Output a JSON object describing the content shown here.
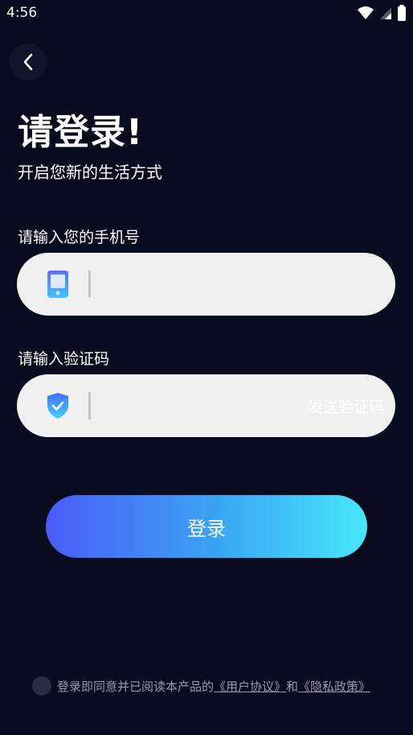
{
  "status_bar": {
    "time": "4:56"
  },
  "header": {
    "title": "请登录!",
    "subtitle": "开启您新的生活方式"
  },
  "phone": {
    "label": "请输入您的手机号",
    "value": ""
  },
  "code": {
    "label": "请输入验证码",
    "value": "",
    "send_label": "发送验证码"
  },
  "login_button": {
    "label": "登录"
  },
  "agreement": {
    "prefix": "登录即同意并已阅读本产品的",
    "user_agreement": "《用户协议》",
    "conj": "和",
    "privacy_policy": "《隐私政策》"
  },
  "colors": {
    "background": "#090b1f",
    "input_bg": "#f0f0f0",
    "accent_start": "#4a5cf7",
    "accent_end": "#47e7fb"
  },
  "icons": {
    "back": "chevron-left-icon",
    "phone": "phone-icon",
    "shield": "shield-check-icon",
    "wifi": "wifi-icon",
    "signal": "signal-icon",
    "battery": "battery-icon"
  }
}
